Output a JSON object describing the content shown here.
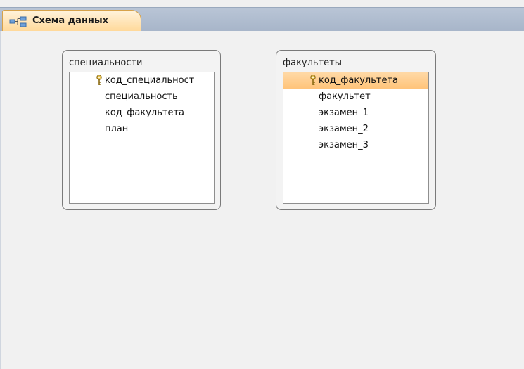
{
  "tab": {
    "title": "Схема данных",
    "icon": "relationships-icon"
  },
  "tables": [
    {
      "title": "специальности",
      "fields": [
        {
          "label": "код_специальност",
          "primary_key": true,
          "selected": false
        },
        {
          "label": "специальность",
          "primary_key": false,
          "selected": false
        },
        {
          "label": "код_факультета",
          "primary_key": false,
          "selected": false
        },
        {
          "label": "план",
          "primary_key": false,
          "selected": false
        }
      ]
    },
    {
      "title": "факультеты",
      "fields": [
        {
          "label": "код_факультета",
          "primary_key": true,
          "selected": true
        },
        {
          "label": "факультет",
          "primary_key": false,
          "selected": false
        },
        {
          "label": "экзамен_1",
          "primary_key": false,
          "selected": false
        },
        {
          "label": "экзамен_2",
          "primary_key": false,
          "selected": false
        },
        {
          "label": "экзамен_3",
          "primary_key": false,
          "selected": false
        }
      ]
    }
  ],
  "colors": {
    "selected_row": "#ffc47a",
    "tab_accent": "#ffd99a",
    "tab_bar": "#a7b5c9"
  }
}
